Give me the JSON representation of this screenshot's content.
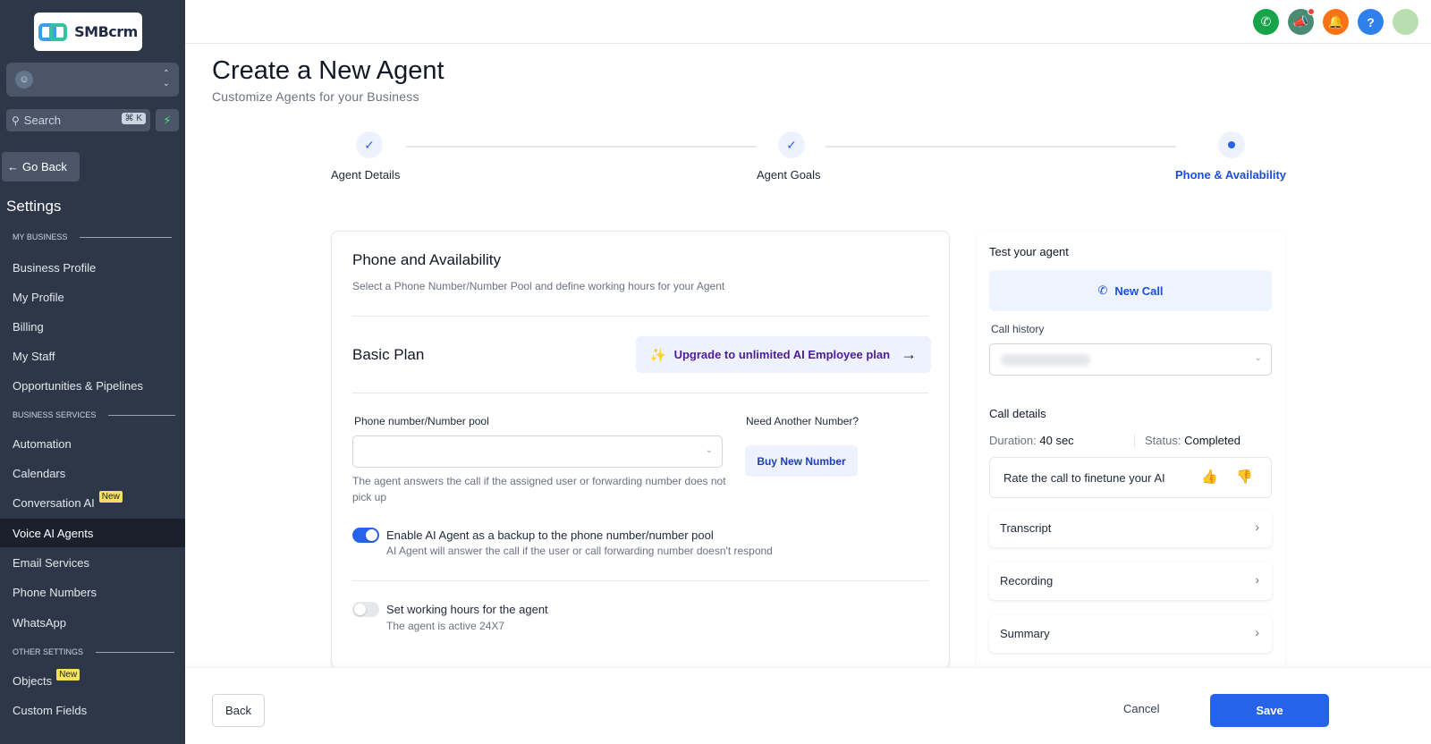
{
  "sidebar": {
    "logo_text": "SMBcrm",
    "search_placeholder": "Search",
    "search_shortcut": "⌘ K",
    "go_back": "Go Back",
    "settings_title": "Settings",
    "sections": {
      "my_business": "MY BUSINESS",
      "business_services": "BUSINESS SERVICES",
      "other_settings": "OTHER SETTINGS"
    },
    "items": {
      "business_profile": "Business Profile",
      "my_profile": "My Profile",
      "billing": "Billing",
      "my_staff": "My Staff",
      "opportunities": "Opportunities & Pipelines",
      "automation": "Automation",
      "calendars": "Calendars",
      "conversation_ai": "Conversation AI",
      "voice_ai_agents": "Voice AI Agents",
      "email_services": "Email Services",
      "phone_numbers": "Phone Numbers",
      "whatsapp": "WhatsApp",
      "objects": "Objects",
      "custom_fields": "Custom Fields"
    },
    "badge_new": "New",
    "active_item": "Voice AI Agents"
  },
  "topbar": {
    "icons": [
      "phone-icon",
      "megaphone-icon",
      "bell-icon",
      "help-icon",
      "user-avatar"
    ],
    "colors": {
      "phone": "#16a34a",
      "megaphone": "#4b8a73",
      "bell": "#f97316",
      "help": "#2f80ed"
    }
  },
  "header": {
    "title": "Create a New Agent",
    "subtitle": "Customize Agents for your Business"
  },
  "stepper": {
    "steps": [
      {
        "label": "Agent Details",
        "state": "done"
      },
      {
        "label": "Agent Goals",
        "state": "done"
      },
      {
        "label": "Phone & Availability",
        "state": "current"
      }
    ]
  },
  "main_card": {
    "title": "Phone and Availability",
    "description": "Select a Phone Number/Number Pool and define working hours for your Agent",
    "plan_name": "Basic Plan",
    "upgrade_label": "Upgrade to unlimited AI Employee plan",
    "phone_field_label": "Phone number/Number pool",
    "phone_field_value": "",
    "phone_helper": "The agent answers the call if the assigned user or forwarding number does not pick up",
    "need_number_label": "Need Another Number?",
    "buy_number_label": "Buy New Number",
    "backup_toggle": {
      "title": "Enable AI Agent as a backup to the phone number/number pool",
      "subtitle": "AI Agent will answer the call if the user or call forwarding number doesn't respond",
      "on": true
    },
    "hours_toggle": {
      "title": "Set working hours for the agent",
      "subtitle": "The agent is active 24X7",
      "on": false
    }
  },
  "test_panel": {
    "title": "Test your agent",
    "new_call_label": "New Call",
    "call_history_label": "Call history",
    "call_details_label": "Call details",
    "duration_label": "Duration:",
    "duration_value": "40 sec",
    "status_label": "Status:",
    "status_value": "Completed",
    "rate_label": "Rate the call to finetune your AI",
    "sections": [
      "Transcript",
      "Recording",
      "Summary"
    ]
  },
  "footer": {
    "back_label": "Back",
    "cancel_label": "Cancel",
    "save_label": "Save"
  },
  "colors": {
    "sidebar_bg": "#2d3748",
    "accent": "#2563eb"
  }
}
